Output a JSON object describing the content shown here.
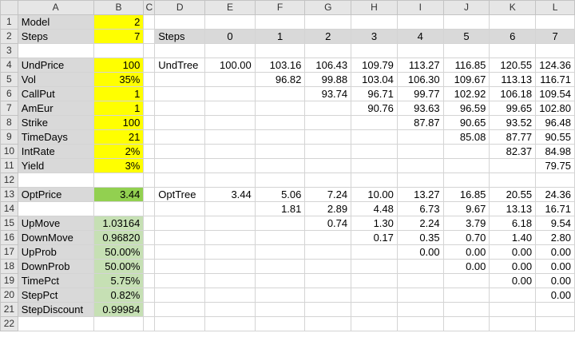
{
  "columns": [
    "A",
    "B",
    "C",
    "D",
    "E",
    "F",
    "G",
    "H",
    "I",
    "J",
    "K",
    "L"
  ],
  "rows": [
    "1",
    "2",
    "3",
    "4",
    "5",
    "6",
    "7",
    "8",
    "9",
    "10",
    "11",
    "12",
    "13",
    "14",
    "15",
    "16",
    "17",
    "18",
    "19",
    "20",
    "21",
    "22"
  ],
  "params": {
    "model": {
      "label": "Model",
      "value": "2"
    },
    "steps": {
      "label": "Steps",
      "value": "7"
    },
    "undprice": {
      "label": "UndPrice",
      "value": "100"
    },
    "vol": {
      "label": "Vol",
      "value": "35%"
    },
    "callput": {
      "label": "CallPut",
      "value": "1"
    },
    "ameur": {
      "label": "AmEur",
      "value": "1"
    },
    "strike": {
      "label": "Strike",
      "value": "100"
    },
    "timedays": {
      "label": "TimeDays",
      "value": "21"
    },
    "intrate": {
      "label": "IntRate",
      "value": "2%"
    },
    "yield": {
      "label": "Yield",
      "value": "3%"
    }
  },
  "outputs": {
    "optprice": {
      "label": "OptPrice",
      "value": "3.44"
    },
    "upmove": {
      "label": "UpMove",
      "value": "1.03164"
    },
    "downmove": {
      "label": "DownMove",
      "value": "0.96820"
    },
    "upprob": {
      "label": "UpProb",
      "value": "50.00%"
    },
    "downprob": {
      "label": "DownProb",
      "value": "50.00%"
    },
    "timepct": {
      "label": "TimePct",
      "value": "5.75%"
    },
    "steppct": {
      "label": "StepPct",
      "value": "0.82%"
    },
    "stepdiscount": {
      "label": "StepDiscount",
      "value": "0.99984"
    }
  },
  "tree_header": {
    "label": "Steps",
    "steps": [
      "0",
      "1",
      "2",
      "3",
      "4",
      "5",
      "6",
      "7"
    ]
  },
  "und_tree": {
    "label": "UndTree",
    "rows": [
      [
        "100.00",
        "103.16",
        "106.43",
        "109.79",
        "113.27",
        "116.85",
        "120.55",
        "124.36"
      ],
      [
        "",
        "96.82",
        "99.88",
        "103.04",
        "106.30",
        "109.67",
        "113.13",
        "116.71"
      ],
      [
        "",
        "",
        "93.74",
        "96.71",
        "99.77",
        "102.92",
        "106.18",
        "109.54"
      ],
      [
        "",
        "",
        "",
        "90.76",
        "93.63",
        "96.59",
        "99.65",
        "102.80"
      ],
      [
        "",
        "",
        "",
        "",
        "87.87",
        "90.65",
        "93.52",
        "96.48"
      ],
      [
        "",
        "",
        "",
        "",
        "",
        "85.08",
        "87.77",
        "90.55"
      ],
      [
        "",
        "",
        "",
        "",
        "",
        "",
        "82.37",
        "84.98"
      ],
      [
        "",
        "",
        "",
        "",
        "",
        "",
        "",
        "79.75"
      ]
    ]
  },
  "opt_tree": {
    "label": "OptTree",
    "rows": [
      [
        "3.44",
        "5.06",
        "7.24",
        "10.00",
        "13.27",
        "16.85",
        "20.55",
        "24.36"
      ],
      [
        "",
        "1.81",
        "2.89",
        "4.48",
        "6.73",
        "9.67",
        "13.13",
        "16.71"
      ],
      [
        "",
        "",
        "0.74",
        "1.30",
        "2.24",
        "3.79",
        "6.18",
        "9.54"
      ],
      [
        "",
        "",
        "",
        "0.17",
        "0.35",
        "0.70",
        "1.40",
        "2.80"
      ],
      [
        "",
        "",
        "",
        "",
        "0.00",
        "0.00",
        "0.00",
        "0.00"
      ],
      [
        "",
        "",
        "",
        "",
        "",
        "0.00",
        "0.00",
        "0.00"
      ],
      [
        "",
        "",
        "",
        "",
        "",
        "",
        "0.00",
        "0.00"
      ],
      [
        "",
        "",
        "",
        "",
        "",
        "",
        "",
        "0.00"
      ]
    ]
  }
}
